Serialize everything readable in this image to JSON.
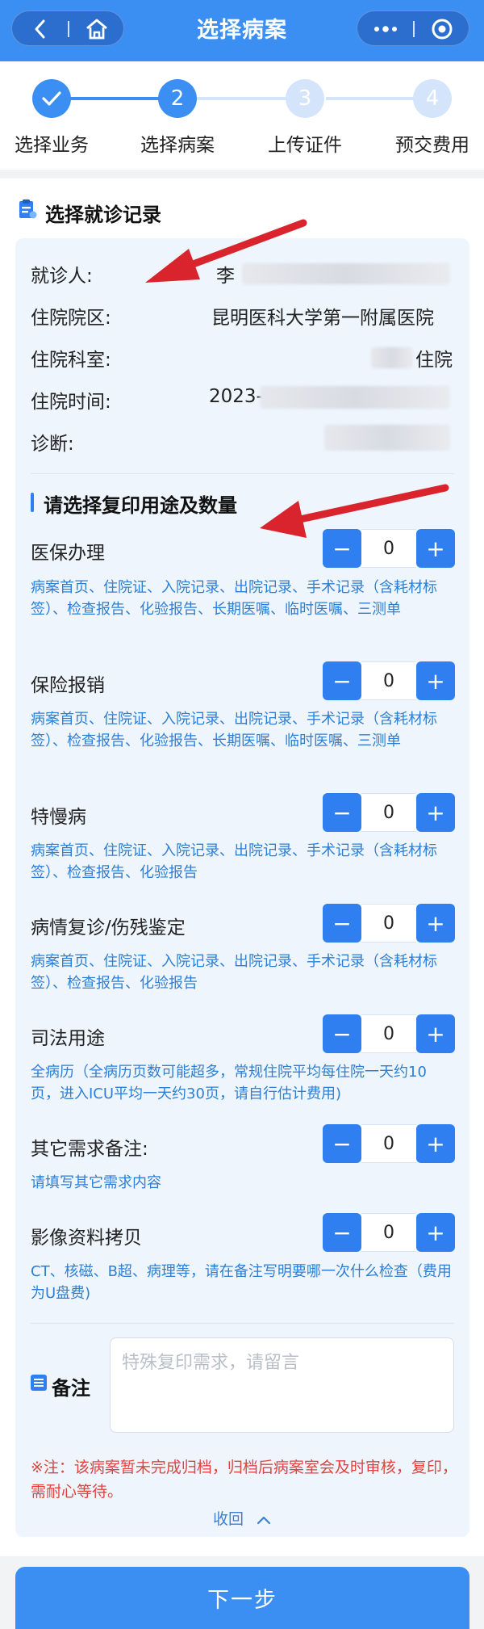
{
  "header": {
    "title": "选择病案",
    "back_icon": "back-arrow-icon",
    "home_icon": "home-icon",
    "more_icon": "more-dots-icon",
    "close_icon": "target-close-icon"
  },
  "steps": [
    {
      "label": "选择业务",
      "number": "",
      "state": "done"
    },
    {
      "label": "选择病案",
      "number": "2",
      "state": "active"
    },
    {
      "label": "上传证件",
      "number": "3",
      "state": "todo"
    },
    {
      "label": "预交费用",
      "number": "4",
      "state": "todo"
    }
  ],
  "record": {
    "section_title": "选择就诊记录",
    "fields": [
      {
        "label": "就诊人:",
        "value": "李"
      },
      {
        "label": "住院院区:",
        "value": "昆明医科大学第一附属医院"
      },
      {
        "label": "住院科室:",
        "value": "住院"
      },
      {
        "label": "住院时间:",
        "value": "2023-"
      },
      {
        "label": "诊断:",
        "value": ""
      }
    ]
  },
  "purpose": {
    "title": "请选择复印用途及数量",
    "items": [
      {
        "name": "医保办理",
        "count": "0",
        "desc": "病案首页、住院证、入院记录、出院记录、手术记录（含耗材标签）、检查报告、化验报告、长期医嘱、临时医嘱、三测单"
      },
      {
        "name": "保险报销",
        "count": "0",
        "desc": "病案首页、住院证、入院记录、出院记录、手术记录（含耗材标签）、检查报告、化验报告、长期医嘱、临时医嘱、三测单"
      },
      {
        "name": "特慢病",
        "count": "0",
        "desc": "病案首页、住院证、入院记录、出院记录、手术记录（含耗材标签）、检查报告、化验报告"
      },
      {
        "name": "病情复诊/伤残鉴定",
        "count": "0",
        "desc": "病案首页、住院证、入院记录、出院记录、手术记录（含耗材标签）、检查报告、化验报告"
      },
      {
        "name": "司法用途",
        "count": "0",
        "desc": "全病历（全病历页数可能超多，常规住院平均每住院一天约10页，进入ICU平均一天约30页，请自行估计费用)"
      },
      {
        "name": "其它需求备注:",
        "count": "0",
        "desc": "请填写其它需求内容"
      },
      {
        "name": "影像资料拷贝",
        "count": "0",
        "desc": "CT、核磁、B超、病理等，请在备注写明要哪一次什么检查（费用为U盘费)"
      }
    ],
    "minus": "−",
    "plus": "+"
  },
  "remark": {
    "label": "备注",
    "placeholder": "特殊复印需求，请留言"
  },
  "note": "※注：该病案暂未完成归档，归档后病案室会及时审核，复印，需耐心等待。",
  "collapse_label": "收回",
  "next_button": "下一步",
  "colors": {
    "primary": "#3b8ff3",
    "desc": "#2d7fd6",
    "note": "#e0443f",
    "annotation_arrow": "#d9232d"
  }
}
